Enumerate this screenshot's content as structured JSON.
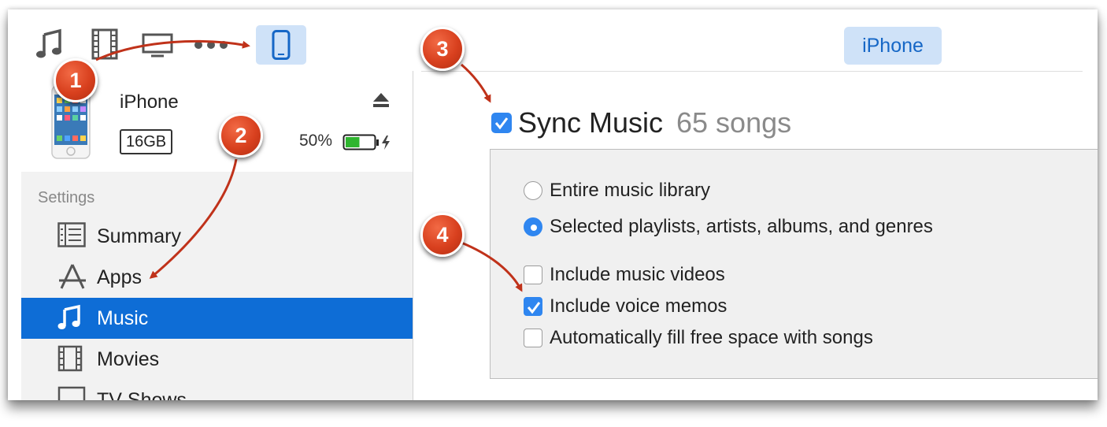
{
  "toolbar": {
    "icons": [
      "music-note-icon",
      "film-icon",
      "tv-icon",
      "more-icon",
      "iphone-icon"
    ],
    "device_pill": "iPhone"
  },
  "device": {
    "name": "iPhone",
    "capacity": "16GB",
    "battery_text": "50%",
    "battery_level": 0.5
  },
  "sidebar": {
    "section_label": "Settings",
    "items": [
      {
        "label": "Summary",
        "icon": "summary-icon"
      },
      {
        "label": "Apps",
        "icon": "apps-icon"
      },
      {
        "label": "Music",
        "icon": "music-note-icon",
        "selected": true
      },
      {
        "label": "Movies",
        "icon": "film-icon"
      },
      {
        "label": "TV Shows",
        "icon": "tv-icon"
      }
    ]
  },
  "main": {
    "sync_title": "Sync Music",
    "sync_count": "65 songs",
    "sync_checked": true,
    "radio_options": [
      {
        "label": "Entire music library",
        "selected": false
      },
      {
        "label": "Selected playlists, artists, albums, and genres",
        "selected": true
      }
    ],
    "checkbox_options": [
      {
        "label": "Include music videos",
        "checked": false
      },
      {
        "label": "Include voice memos",
        "checked": true
      },
      {
        "label": "Automatically fill free space with songs",
        "checked": false
      }
    ]
  },
  "callouts": [
    "1",
    "2",
    "3",
    "4"
  ],
  "colors": {
    "accent": "#0e6dd6",
    "checkbox_blue": "#2f86f0",
    "pill_bg": "#cfe2f8",
    "callout_red": "#d8401e",
    "arrow_red": "#c0321a"
  }
}
